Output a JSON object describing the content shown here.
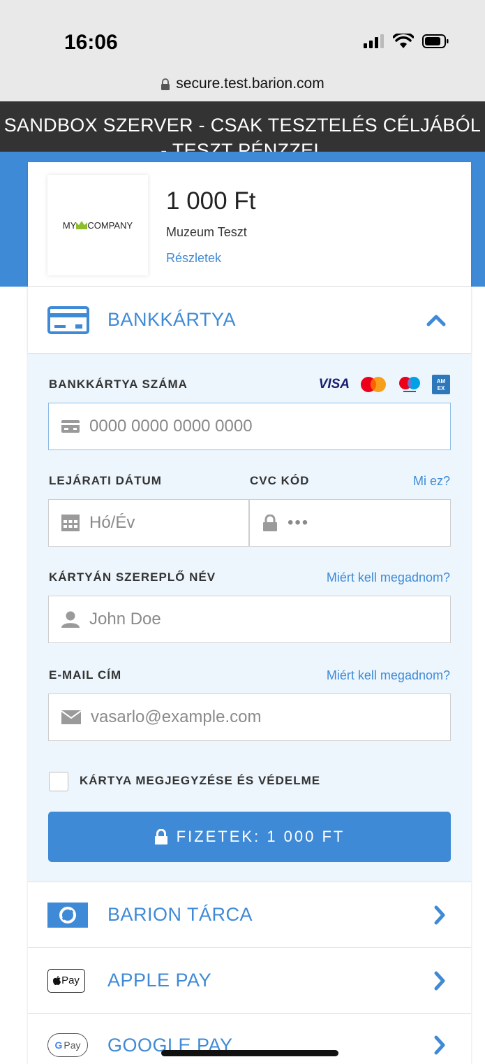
{
  "status": {
    "time": "16:06"
  },
  "browser": {
    "url": "secure.test.barion.com"
  },
  "banner": {
    "text": "SANDBOX SZERVER - CSAK TESZTELÉS CÉLJÁBÓL - TESZT PÉNZZEL"
  },
  "merchant": {
    "logo_text_left": "MY",
    "logo_text_right": "COMPANY",
    "amount": "1 000 Ft",
    "name": "Muzeum Teszt",
    "details_link": "Részletek"
  },
  "bankcard": {
    "title": "BANKKÁRTYA",
    "card_number_label": "BANKKÁRTYA SZÁMA",
    "card_brands": [
      "VISA",
      "mastercard",
      "maestro",
      "amex"
    ],
    "card_number_placeholder": "0000 0000 0000 0000",
    "expiry_label": "LEJÁRATI DÁTUM",
    "expiry_placeholder": "Hó/Év",
    "cvc_label": "CVC KÓD",
    "cvc_help": "Mi ez?",
    "cvc_placeholder": "•••",
    "name_label": "KÁRTYÁN SZEREPLŐ NÉV",
    "name_help": "Miért kell megadnom?",
    "name_placeholder": "John Doe",
    "email_label": "E-MAIL CÍM",
    "email_help": "Miért kell megadnom?",
    "email_placeholder": "vasarlo@example.com",
    "remember_label": "KÁRTYA MEGJEGYZÉSE ÉS VÉDELME",
    "pay_button": "FIZETEK: 1 000 FT"
  },
  "methods": [
    {
      "label": "BARION TÁRCA"
    },
    {
      "label": "APPLE PAY",
      "badge": "Pay"
    },
    {
      "label": "GOOGLE PAY",
      "badge": "Pay"
    }
  ],
  "colors": {
    "accent": "#3f8ad6",
    "banner": "#333333",
    "form_bg": "#edf6fd"
  }
}
